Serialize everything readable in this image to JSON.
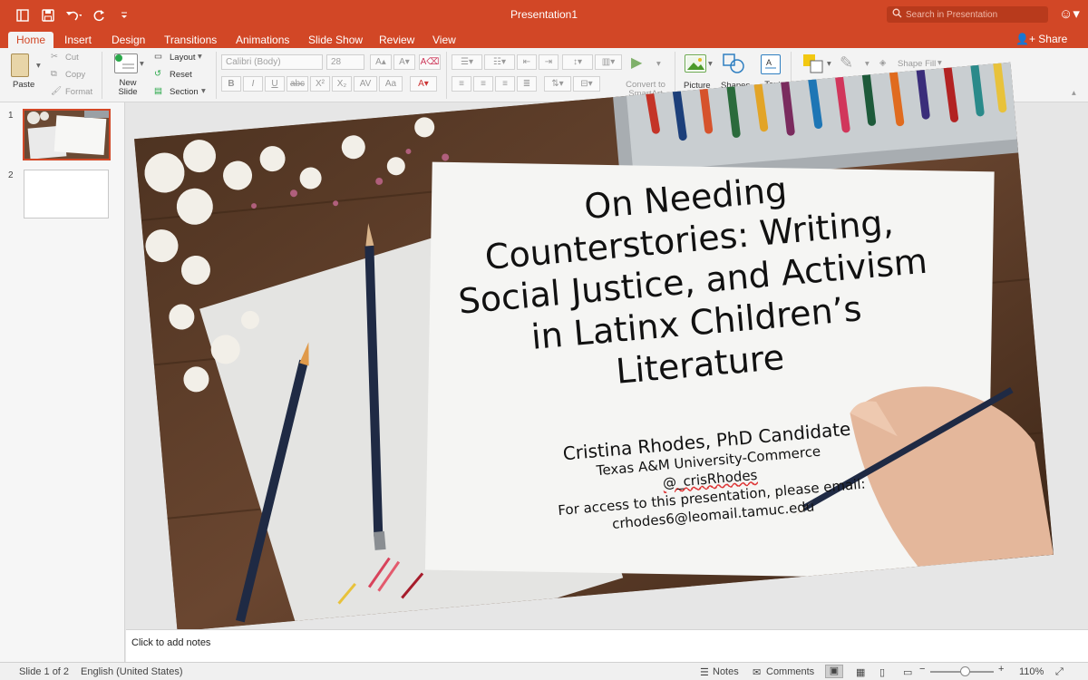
{
  "window": {
    "title": "Presentation1",
    "search_placeholder": "Search in Presentation"
  },
  "quick_access": [
    "sidebar-toggle-icon",
    "save-icon",
    "undo-icon",
    "redo-icon",
    "customize-icon"
  ],
  "tabs": [
    "Home",
    "Insert",
    "Design",
    "Transitions",
    "Animations",
    "Slide Show",
    "Review",
    "View"
  ],
  "active_tab": "Home",
  "share_label": "Share",
  "ribbon": {
    "paste": "Paste",
    "cut": "Cut",
    "copy": "Copy",
    "format": "Format",
    "new_slide": "New Slide",
    "layout": "Layout",
    "reset": "Reset",
    "section": "Section",
    "font_name": "Calibri (Body)",
    "font_size": "28",
    "convert_smartart": "Convert to SmartArt",
    "picture": "Picture",
    "shapes": "Shapes",
    "text_box": "Text Box",
    "arrange": "Arrange",
    "quick_styles": "Quick Styles",
    "shape_fill": "Shape Fill",
    "shape_outline": "Shape Outline"
  },
  "thumbnails": [
    {
      "number": "1",
      "title": "On Needing Counterstories: Writing, Social Justice, and Activism in Latinx Children's Literature"
    },
    {
      "number": "2",
      "title": ""
    }
  ],
  "slide": {
    "title_lines": [
      "On Needing",
      "Counterstories: Writing,",
      "Social Justice, and Activism",
      "in Latinx Children’s",
      "Literature"
    ],
    "author": "Cristina Rhodes, PhD Candidate",
    "affiliation": "Texas A&M University-Commerce",
    "handle": "@_crisRhodes",
    "access_note": "For access to this presentation, please email:",
    "email": "crhodes6@leomail.tamuc.edu"
  },
  "notes_placeholder": "Click to add notes",
  "status": {
    "slide_count": "Slide 1 of 2",
    "language": "English (United States)",
    "notes": "Notes",
    "comments": "Comments",
    "zoom": "110%",
    "zoom_fraction": 0.55
  },
  "colors": {
    "accent": "#d24726",
    "ribbon_bg": "#f3f3f3",
    "wood": "#5a3b26"
  }
}
